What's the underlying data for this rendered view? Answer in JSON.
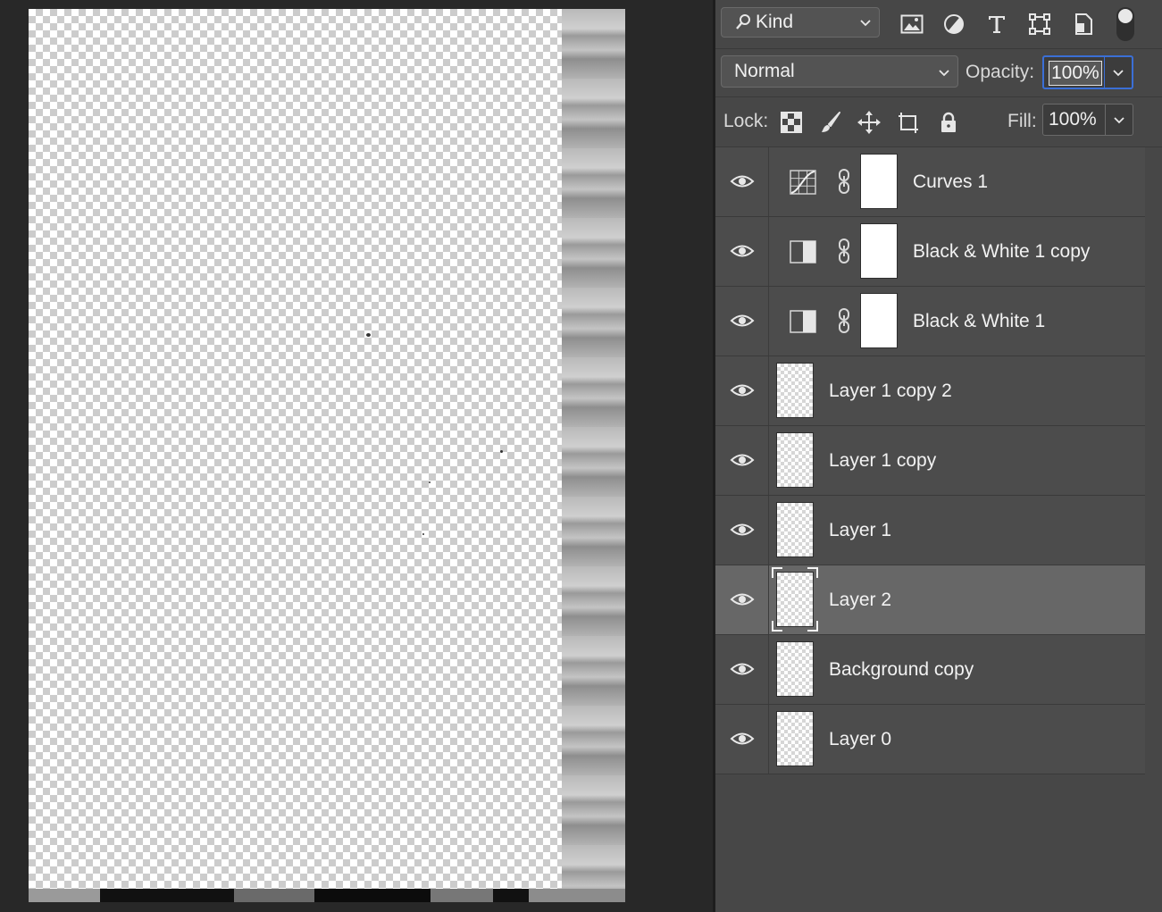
{
  "panel": {
    "filter": {
      "kind_label": "Kind"
    },
    "filter_icons": [
      "image-filter-icon",
      "adjustment-filter-icon",
      "type-filter-icon",
      "shape-filter-icon",
      "smart-object-filter-icon"
    ],
    "blend_mode": "Normal",
    "opacity_label": "Opacity:",
    "opacity_value": "100%",
    "lock_label": "Lock:",
    "fill_label": "Fill:",
    "fill_value": "100%"
  },
  "layers": [
    {
      "name": "Curves 1",
      "kind": "adjustment",
      "icon": "curves-icon",
      "visible": true,
      "selected": false
    },
    {
      "name": "Black & White 1 copy",
      "kind": "adjustment",
      "icon": "black-white-icon",
      "visible": true,
      "selected": false
    },
    {
      "name": "Black & White 1",
      "kind": "adjustment",
      "icon": "black-white-icon",
      "visible": true,
      "selected": false
    },
    {
      "name": "Layer 1 copy 2",
      "kind": "pixel",
      "visible": true,
      "selected": false
    },
    {
      "name": "Layer 1 copy",
      "kind": "pixel",
      "visible": true,
      "selected": false
    },
    {
      "name": "Layer 1",
      "kind": "pixel",
      "visible": true,
      "selected": false
    },
    {
      "name": "Layer 2",
      "kind": "pixel",
      "visible": true,
      "selected": true
    },
    {
      "name": "Background copy",
      "kind": "pixel",
      "visible": true,
      "selected": false
    },
    {
      "name": "Layer 0",
      "kind": "pixel",
      "visible": true,
      "selected": false
    }
  ],
  "colors": {
    "panel_bg": "#474747",
    "row_bg": "#4c4c4c",
    "selected_row": "#676767",
    "focus_blue": "#3b6fd6"
  }
}
